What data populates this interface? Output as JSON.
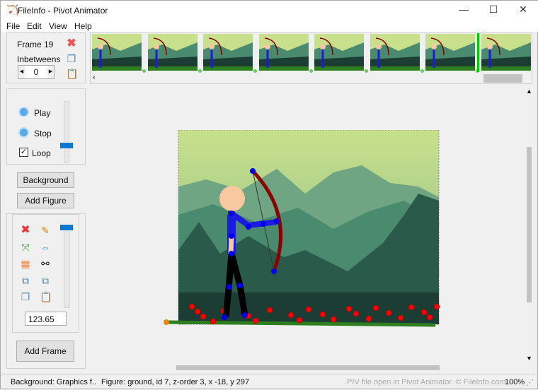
{
  "window": {
    "title": "FileInfo - Pivot Animator",
    "controls": [
      "minimize",
      "maximize",
      "close"
    ]
  },
  "menu": [
    "File",
    "Edit",
    "View",
    "Help"
  ],
  "frame_panel": {
    "frame_label": "Frame 19",
    "inbetweens_label": "Inbetweens",
    "inbetweens_value": "0"
  },
  "playback": {
    "play": "Play",
    "stop": "Stop",
    "loop": "Loop",
    "loop_checked": true,
    "speed_level": 0.6
  },
  "buttons": {
    "background": "Background",
    "add_figure": "Add Figure",
    "add_frame": "Add Frame"
  },
  "figure_tools": {
    "scale_value": "123.65",
    "size_level": 0.05
  },
  "timeline": {
    "frame_count_visible": 8,
    "selected_index": 7
  },
  "status": {
    "background": "Background: Graphics f..",
    "figure": "Figure: ground,  id 7,  z-order 3,  x -18, y 297",
    "info": ".PIV file open in Pivot Animator. © FileInfo.com",
    "zoom": "100%"
  },
  "colors": {
    "accent": "#0078d7",
    "joint": "#0000ee",
    "ground_joint": "#ff0000",
    "bow": "#8b0000",
    "selected_frame": "#00cc00"
  }
}
